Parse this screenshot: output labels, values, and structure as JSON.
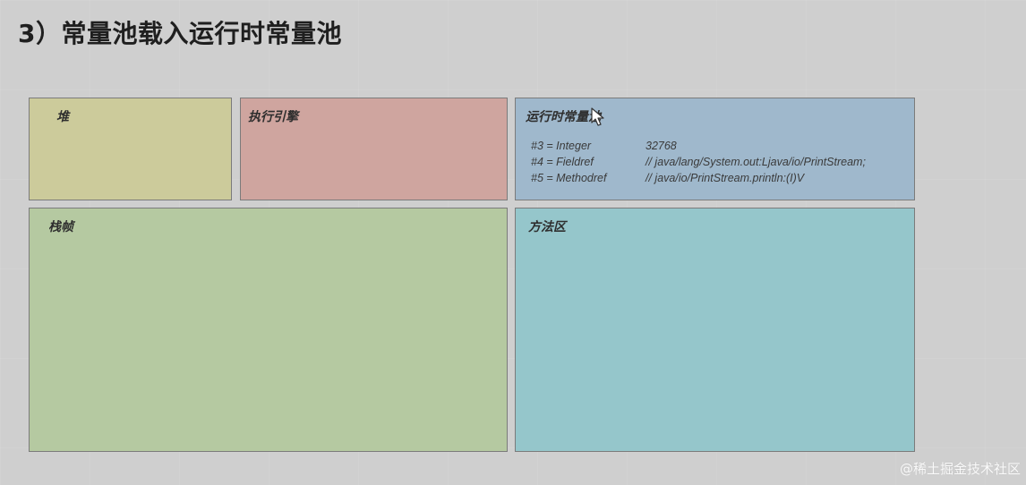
{
  "title": "3）常量池载入运行时常量池",
  "boxes": {
    "heap": "堆",
    "execution_engine": "执行引擎",
    "runtime_constant_pool": "运行时常量池",
    "stack_frame": "栈帧",
    "method_area": "方法区"
  },
  "constant_pool_entries": [
    {
      "ref": "#3 = Integer",
      "value": "32768"
    },
    {
      "ref": "#4 = Fieldref",
      "value": "// java/lang/System.out:Ljava/io/PrintStream;"
    },
    {
      "ref": "#5 = Methodref",
      "value": "// java/io/PrintStream.println:(I)V"
    }
  ],
  "watermark": "@稀土掘金技术社区",
  "colors": {
    "heap": "#cccb9b",
    "execution_engine": "#cfa59f",
    "runtime_constant_pool": "#9fb8cc",
    "stack_frame": "#b5c9a1",
    "method_area": "#95c6cb"
  },
  "icons": {
    "cursor": "mouse-pointer-icon"
  }
}
